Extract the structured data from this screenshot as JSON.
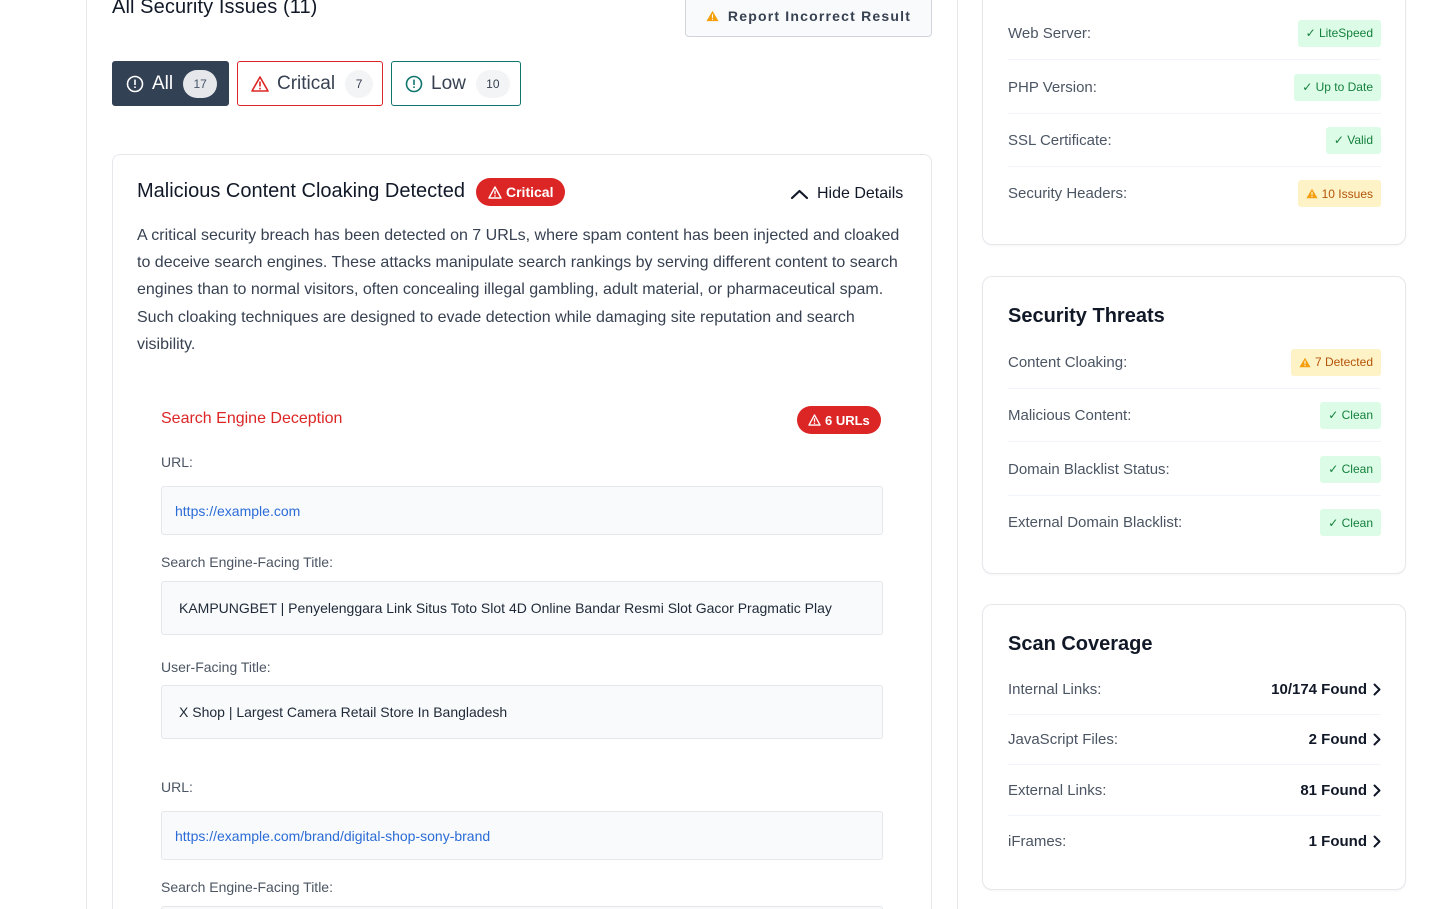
{
  "header": {
    "title": "All Security Issues (11)",
    "report_button": "Report Incorrect Result"
  },
  "filters": [
    {
      "label": "All",
      "count": "17"
    },
    {
      "label": "Critical",
      "count": "7"
    },
    {
      "label": "Low",
      "count": "10"
    }
  ],
  "issue": {
    "title": "Malicious Content Cloaking Detected",
    "severity": "Critical",
    "toggle_label": "Hide Details",
    "description": "A critical security breach has been detected on 7 URLs, where spam content has been injected and cloaked to deceive search engines. These attacks manipulate search rankings by serving different content to search engines than to normal visitors, often concealing illegal gambling, adult material, or pharmaceutical spam. Such cloaking techniques are designed to evade detection while damaging site reputation and search visibility.",
    "section_title": "Search Engine Deception",
    "section_badge": "6 URLs",
    "entries": [
      {
        "url_label": "URL:",
        "url": "https://example.com",
        "se_title_label": "Search Engine-Facing Title:",
        "se_title": "KAMPUNGBET | Penyelenggara Link Situs Toto Slot 4D Online Bandar Resmi Slot Gacor Pragmatic Play",
        "user_title_label": "User-Facing Title:",
        "user_title": "X Shop | Largest Camera Retail Store In Bangladesh"
      },
      {
        "url_label": "URL:",
        "url": "https://example.com/brand/digital-shop-sony-brand",
        "se_title_label": "Search Engine-Facing Title:"
      }
    ]
  },
  "server_info": {
    "rows": [
      {
        "label": "Web Server:",
        "value": "✓ LiteSpeed",
        "status": "ok"
      },
      {
        "label": "PHP Version:",
        "value": "✓ Up to Date",
        "status": "ok"
      },
      {
        "label": "SSL Certificate:",
        "value": "✓ Valid",
        "status": "ok"
      },
      {
        "label": "Security Headers:",
        "value": "10 Issues",
        "status": "warn"
      }
    ]
  },
  "security_threats": {
    "title": "Security Threats",
    "rows": [
      {
        "label": "Content Cloaking:",
        "value": "7 Detected",
        "status": "warn"
      },
      {
        "label": "Malicious Content:",
        "value": "✓ Clean",
        "status": "ok"
      },
      {
        "label": "Domain Blacklist Status:",
        "value": "✓ Clean",
        "status": "ok"
      },
      {
        "label": "External Domain Blacklist:",
        "value": "✓ Clean",
        "status": "ok"
      }
    ]
  },
  "scan_coverage": {
    "title": "Scan Coverage",
    "rows": [
      {
        "label": "Internal Links:",
        "value": "10/174 Found"
      },
      {
        "label": "JavaScript Files:",
        "value": "2 Found"
      },
      {
        "label": "External Links:",
        "value": "81 Found"
      },
      {
        "label": "iFrames:",
        "value": "1 Found"
      }
    ]
  },
  "colors": {
    "critical": "#dc2626",
    "low": "#0f766e",
    "ok_bg": "#dcfce7",
    "ok_text": "#15803d",
    "warn_bg": "#fef3c7",
    "warn_text": "#b45309",
    "link": "#2b6cd6"
  }
}
